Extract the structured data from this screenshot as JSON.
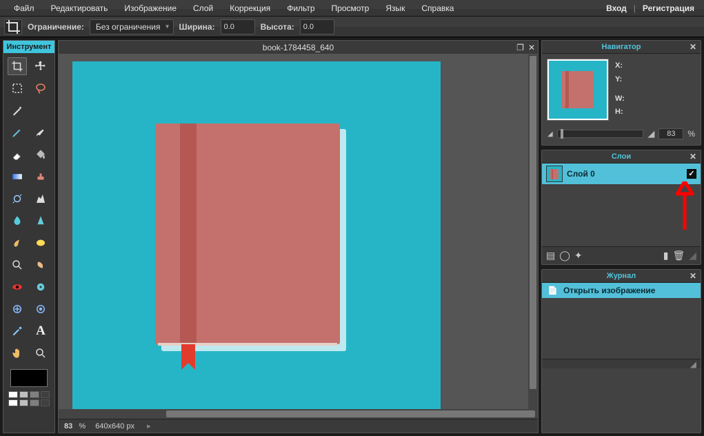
{
  "menu": {
    "items": [
      "Файл",
      "Редактировать",
      "Изображение",
      "Слой",
      "Коррекция",
      "Фильтр",
      "Просмотр",
      "Язык",
      "Справка"
    ],
    "login": "Вход",
    "register": "Регистрация"
  },
  "options": {
    "constraint_label": "Ограничение:",
    "constraint_value": "Без ограничения",
    "width_label": "Ширина:",
    "width_value": "0.0",
    "height_label": "Высота:",
    "height_value": "0.0"
  },
  "tools_panel": {
    "title": "Инструмент"
  },
  "document": {
    "title": "book-1784458_640",
    "zoom_display": "83",
    "zoom_unit": "%",
    "dimensions": "640x640 px"
  },
  "navigator": {
    "title": "Навигатор",
    "x_label": "X:",
    "y_label": "Y:",
    "w_label": "W:",
    "h_label": "H:",
    "zoom_value": "83",
    "zoom_unit": "%"
  },
  "layers": {
    "title": "Слои",
    "items": [
      {
        "name": "Слой 0",
        "visible": true
      }
    ]
  },
  "journal": {
    "title": "Журнал",
    "items": [
      {
        "label": "Открыть изображение"
      }
    ]
  },
  "palette_colors": [
    "#ffffff",
    "#bfbfbf",
    "#7f7f7f",
    "#3f3f3f",
    "#ffffff",
    "#bfbfbf",
    "#7f7f7f",
    "#3f3f3f"
  ]
}
